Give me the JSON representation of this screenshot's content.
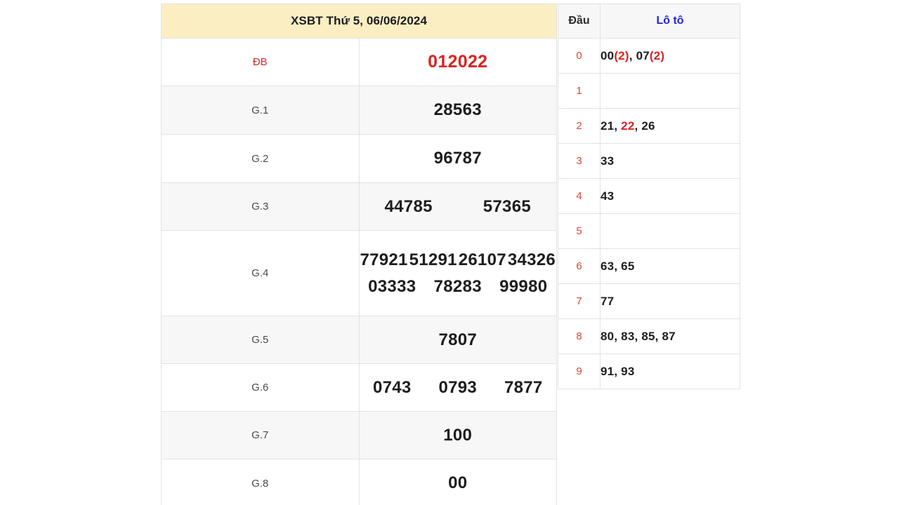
{
  "results": {
    "title": "XSBT Thứ 5, 06/06/2024",
    "rows": [
      {
        "label": "ĐB",
        "special": true,
        "lines": [
          [
            "012022"
          ]
        ]
      },
      {
        "label": "G.1",
        "special": false,
        "lines": [
          [
            "28563"
          ]
        ]
      },
      {
        "label": "G.2",
        "special": false,
        "lines": [
          [
            "96787"
          ]
        ]
      },
      {
        "label": "G.3",
        "special": false,
        "lines": [
          [
            "44785",
            "57365"
          ]
        ]
      },
      {
        "label": "G.4",
        "special": false,
        "lines": [
          [
            "77921",
            "51291",
            "26107",
            "34326"
          ],
          [
            "03333",
            "78283",
            "99980"
          ]
        ]
      },
      {
        "label": "G.5",
        "special": false,
        "lines": [
          [
            "7807"
          ]
        ]
      },
      {
        "label": "G.6",
        "special": false,
        "lines": [
          [
            "0743",
            "0793",
            "7877"
          ]
        ]
      },
      {
        "label": "G.7",
        "special": false,
        "lines": [
          [
            "100"
          ]
        ]
      },
      {
        "label": "G.8",
        "special": false,
        "lines": [
          [
            "00"
          ]
        ]
      }
    ]
  },
  "loto": {
    "header_dau": "Đầu",
    "header_loto": "Lô tô",
    "rows": [
      {
        "dau": "0",
        "numbers": [
          {
            "value": "00",
            "count": "(2)",
            "highlight": false
          },
          {
            "value": "07",
            "count": "(2)",
            "highlight": false
          }
        ]
      },
      {
        "dau": "1",
        "numbers": []
      },
      {
        "dau": "2",
        "numbers": [
          {
            "value": "21",
            "count": "",
            "highlight": false
          },
          {
            "value": "22",
            "count": "",
            "highlight": true
          },
          {
            "value": "26",
            "count": "",
            "highlight": false
          }
        ]
      },
      {
        "dau": "3",
        "numbers": [
          {
            "value": "33",
            "count": "",
            "highlight": false
          }
        ]
      },
      {
        "dau": "4",
        "numbers": [
          {
            "value": "43",
            "count": "",
            "highlight": false
          }
        ]
      },
      {
        "dau": "5",
        "numbers": []
      },
      {
        "dau": "6",
        "numbers": [
          {
            "value": "63",
            "count": "",
            "highlight": false
          },
          {
            "value": "65",
            "count": "",
            "highlight": false
          }
        ]
      },
      {
        "dau": "7",
        "numbers": [
          {
            "value": "77",
            "count": "",
            "highlight": false
          }
        ]
      },
      {
        "dau": "8",
        "numbers": [
          {
            "value": "80",
            "count": "",
            "highlight": false
          },
          {
            "value": "83",
            "count": "",
            "highlight": false
          },
          {
            "value": "85",
            "count": "",
            "highlight": false
          },
          {
            "value": "87",
            "count": "",
            "highlight": false
          }
        ]
      },
      {
        "dau": "9",
        "numbers": [
          {
            "value": "91",
            "count": "",
            "highlight": false
          },
          {
            "value": "93",
            "count": "",
            "highlight": false
          }
        ]
      }
    ]
  },
  "colors": {
    "header_bg": "#fbeec3",
    "special_red": "#dd2222",
    "loto_blue": "#2222dd",
    "dau_red": "#dd4433",
    "row_alt_bg": "#f7f7f7",
    "border": "#e2e2e2"
  }
}
